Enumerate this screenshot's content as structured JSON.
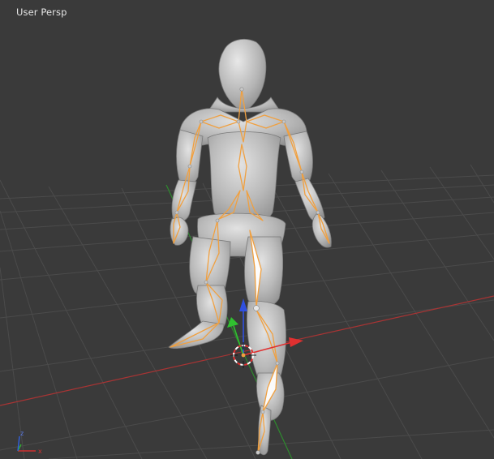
{
  "viewport": {
    "view_label": "User Persp",
    "background_color": "#3a3a3a",
    "grid_color": "#4a4a4a",
    "axis_x_color": "#b03636",
    "axis_y_color": "#2f8a2f",
    "bone_outline_color": "#f0a040"
  },
  "manipulator": {
    "x_arrow_color": "#e03030",
    "y_arrow_color": "#30c030",
    "z_arrow_color": "#3050e0",
    "icon": "transform-manipulator-icon"
  },
  "cursor_3d": {
    "icon": "3d-cursor-icon"
  },
  "orientation_gizmo": {
    "icon": "axis-orientation-icon",
    "x_label": "x",
    "z_label": "z"
  },
  "model": {
    "icon": "character-mesh-icon",
    "armature": "armature-bones"
  }
}
